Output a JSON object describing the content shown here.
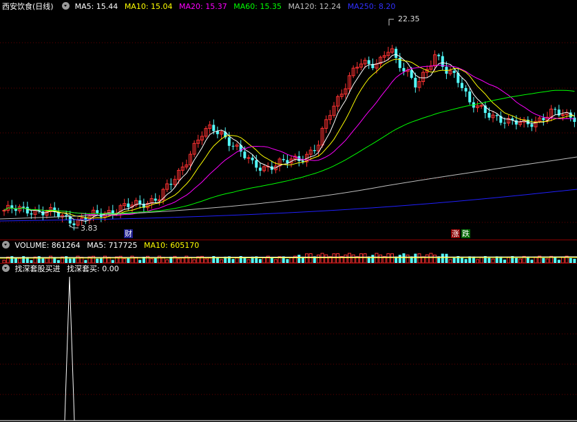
{
  "main": {
    "title": "西安饮食(日线)",
    "ma": [
      {
        "label": "MA5: 15.44",
        "color": "#ffffff"
      },
      {
        "label": "MA10: 15.04",
        "color": "#ffff00"
      },
      {
        "label": "MA20: 15.37",
        "color": "#ff00ff"
      },
      {
        "label": "MA60: 15.35",
        "color": "#00ff00"
      },
      {
        "label": "MA120: 12.24",
        "color": "#c0c0c0"
      },
      {
        "label": "MA250: 8.20",
        "color": "#0000ff"
      }
    ],
    "high_label": "22.35",
    "low_label": "3.83",
    "marker_cai": "财",
    "marker_zhang": "涨",
    "marker_die": "跌"
  },
  "volume": {
    "label": "VOLUME: 861264",
    "ma5": "MA5: 717725",
    "ma10": "MA10: 605170"
  },
  "indicator": {
    "name": "找深套股买进",
    "value_label": "找深套买: 0.00"
  },
  "colors": {
    "up": "#ff3232",
    "down": "#54ffff",
    "grid": "#6a0000",
    "separator": "#8b0000"
  }
}
